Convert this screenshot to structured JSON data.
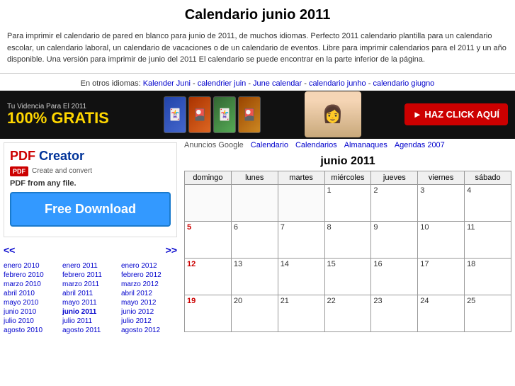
{
  "page": {
    "title": "Calendario junio 2011",
    "description": "Para imprimir el calendario de pared en blanco para junio de 2011, de muchos idiomas. Perfecto 2011 calendario plantilla para un calendario escolar, un calendario laboral, un calendario de vacaciones o de un calendario de eventos. Libre para imprimir calendarios para el 2011 y un año disponible. Una versión para imprimir de junio del 2011 El calendario se puede encontrar en la parte inferior de la página.",
    "other_languages_label": "En otros idiomas:",
    "other_languages_links": [
      {
        "text": "Kalender Juni",
        "href": "#"
      },
      {
        "text": "calendrier juin",
        "href": "#"
      },
      {
        "text": "June calendar",
        "href": "#"
      },
      {
        "text": "calendario junho",
        "href": "#"
      },
      {
        "text": "calendario giugno",
        "href": "#"
      }
    ]
  },
  "banner": {
    "small_text": "Tu Videncia Para El 2011",
    "big_text": "100% GRATIS",
    "cta": "► HAZ CLICK AQUÍ"
  },
  "ad_row": {
    "label": "Anuncios Google",
    "links": [
      {
        "text": "Calendario"
      },
      {
        "text": "Calendarios"
      },
      {
        "text": "Almanaques"
      },
      {
        "text": "Agendas 2007"
      }
    ]
  },
  "pdf_ad": {
    "title_red": "PDF",
    "title_blue": " Creator",
    "subtitle": "Create and convert",
    "desc": "PDF from any file.",
    "download_btn": "Free Download"
  },
  "calendar": {
    "title": "junio 2011",
    "headers": [
      "domingo",
      "lunes",
      "martes",
      "miércoles",
      "jueves",
      "viernes",
      "sábado"
    ],
    "weeks": [
      [
        {
          "day": "",
          "empty": true,
          "sunday": false
        },
        {
          "day": "",
          "empty": true,
          "sunday": false
        },
        {
          "day": "",
          "empty": true,
          "sunday": false
        },
        {
          "day": "1",
          "empty": false,
          "sunday": false
        },
        {
          "day": "2",
          "empty": false,
          "sunday": false
        },
        {
          "day": "3",
          "empty": false,
          "sunday": false
        },
        {
          "day": "4",
          "empty": false,
          "sunday": false
        }
      ],
      [
        {
          "day": "5",
          "empty": false,
          "sunday": true
        },
        {
          "day": "6",
          "empty": false,
          "sunday": false
        },
        {
          "day": "7",
          "empty": false,
          "sunday": false
        },
        {
          "day": "8",
          "empty": false,
          "sunday": false
        },
        {
          "day": "9",
          "empty": false,
          "sunday": false
        },
        {
          "day": "10",
          "empty": false,
          "sunday": false
        },
        {
          "day": "11",
          "empty": false,
          "sunday": false
        }
      ],
      [
        {
          "day": "12",
          "empty": false,
          "sunday": true
        },
        {
          "day": "13",
          "empty": false,
          "sunday": false
        },
        {
          "day": "14",
          "empty": false,
          "sunday": false
        },
        {
          "day": "15",
          "empty": false,
          "sunday": false
        },
        {
          "day": "16",
          "empty": false,
          "sunday": false
        },
        {
          "day": "17",
          "empty": false,
          "sunday": false
        },
        {
          "day": "18",
          "empty": false,
          "sunday": false
        }
      ],
      [
        {
          "day": "19",
          "empty": false,
          "sunday": true
        },
        {
          "day": "20",
          "empty": false,
          "sunday": false
        },
        {
          "day": "21",
          "empty": false,
          "sunday": false
        },
        {
          "day": "22",
          "empty": false,
          "sunday": false
        },
        {
          "day": "23",
          "empty": false,
          "sunday": false
        },
        {
          "day": "24",
          "empty": false,
          "sunday": false
        },
        {
          "day": "25",
          "empty": false,
          "sunday": false
        }
      ]
    ]
  },
  "year_links": {
    "col1": [
      {
        "text": "enero 2010",
        "href": "#"
      },
      {
        "text": "febrero 2010",
        "href": "#"
      },
      {
        "text": "marzo 2010",
        "href": "#"
      },
      {
        "text": "abril 2010",
        "href": "#"
      },
      {
        "text": "mayo 2010",
        "href": "#"
      },
      {
        "text": "junio 2010",
        "href": "#"
      },
      {
        "text": "julio 2010",
        "href": "#"
      },
      {
        "text": "agosto 2010",
        "href": "#"
      }
    ],
    "col2": [
      {
        "text": "enero 2011",
        "href": "#"
      },
      {
        "text": "febrero 2011",
        "href": "#"
      },
      {
        "text": "marzo 2011",
        "href": "#"
      },
      {
        "text": "abril 2011",
        "href": "#"
      },
      {
        "text": "mayo 2011",
        "href": "#"
      },
      {
        "text": "junio 2011",
        "href": "#"
      },
      {
        "text": "julio 2011",
        "href": "#"
      },
      {
        "text": "agosto 2011",
        "href": "#"
      }
    ],
    "col3": [
      {
        "text": "enero 2012",
        "href": "#"
      },
      {
        "text": "febrero 2012",
        "href": "#"
      },
      {
        "text": "marzo 2012",
        "href": "#"
      },
      {
        "text": "abril 2012",
        "href": "#"
      },
      {
        "text": "mayo 2012",
        "href": "#"
      },
      {
        "text": "junio 2012",
        "href": "#"
      },
      {
        "text": "julio 2012",
        "href": "#"
      },
      {
        "text": "agosto 2012",
        "href": "#"
      }
    ]
  },
  "nav": {
    "prev": "<<",
    "next": ">>"
  }
}
